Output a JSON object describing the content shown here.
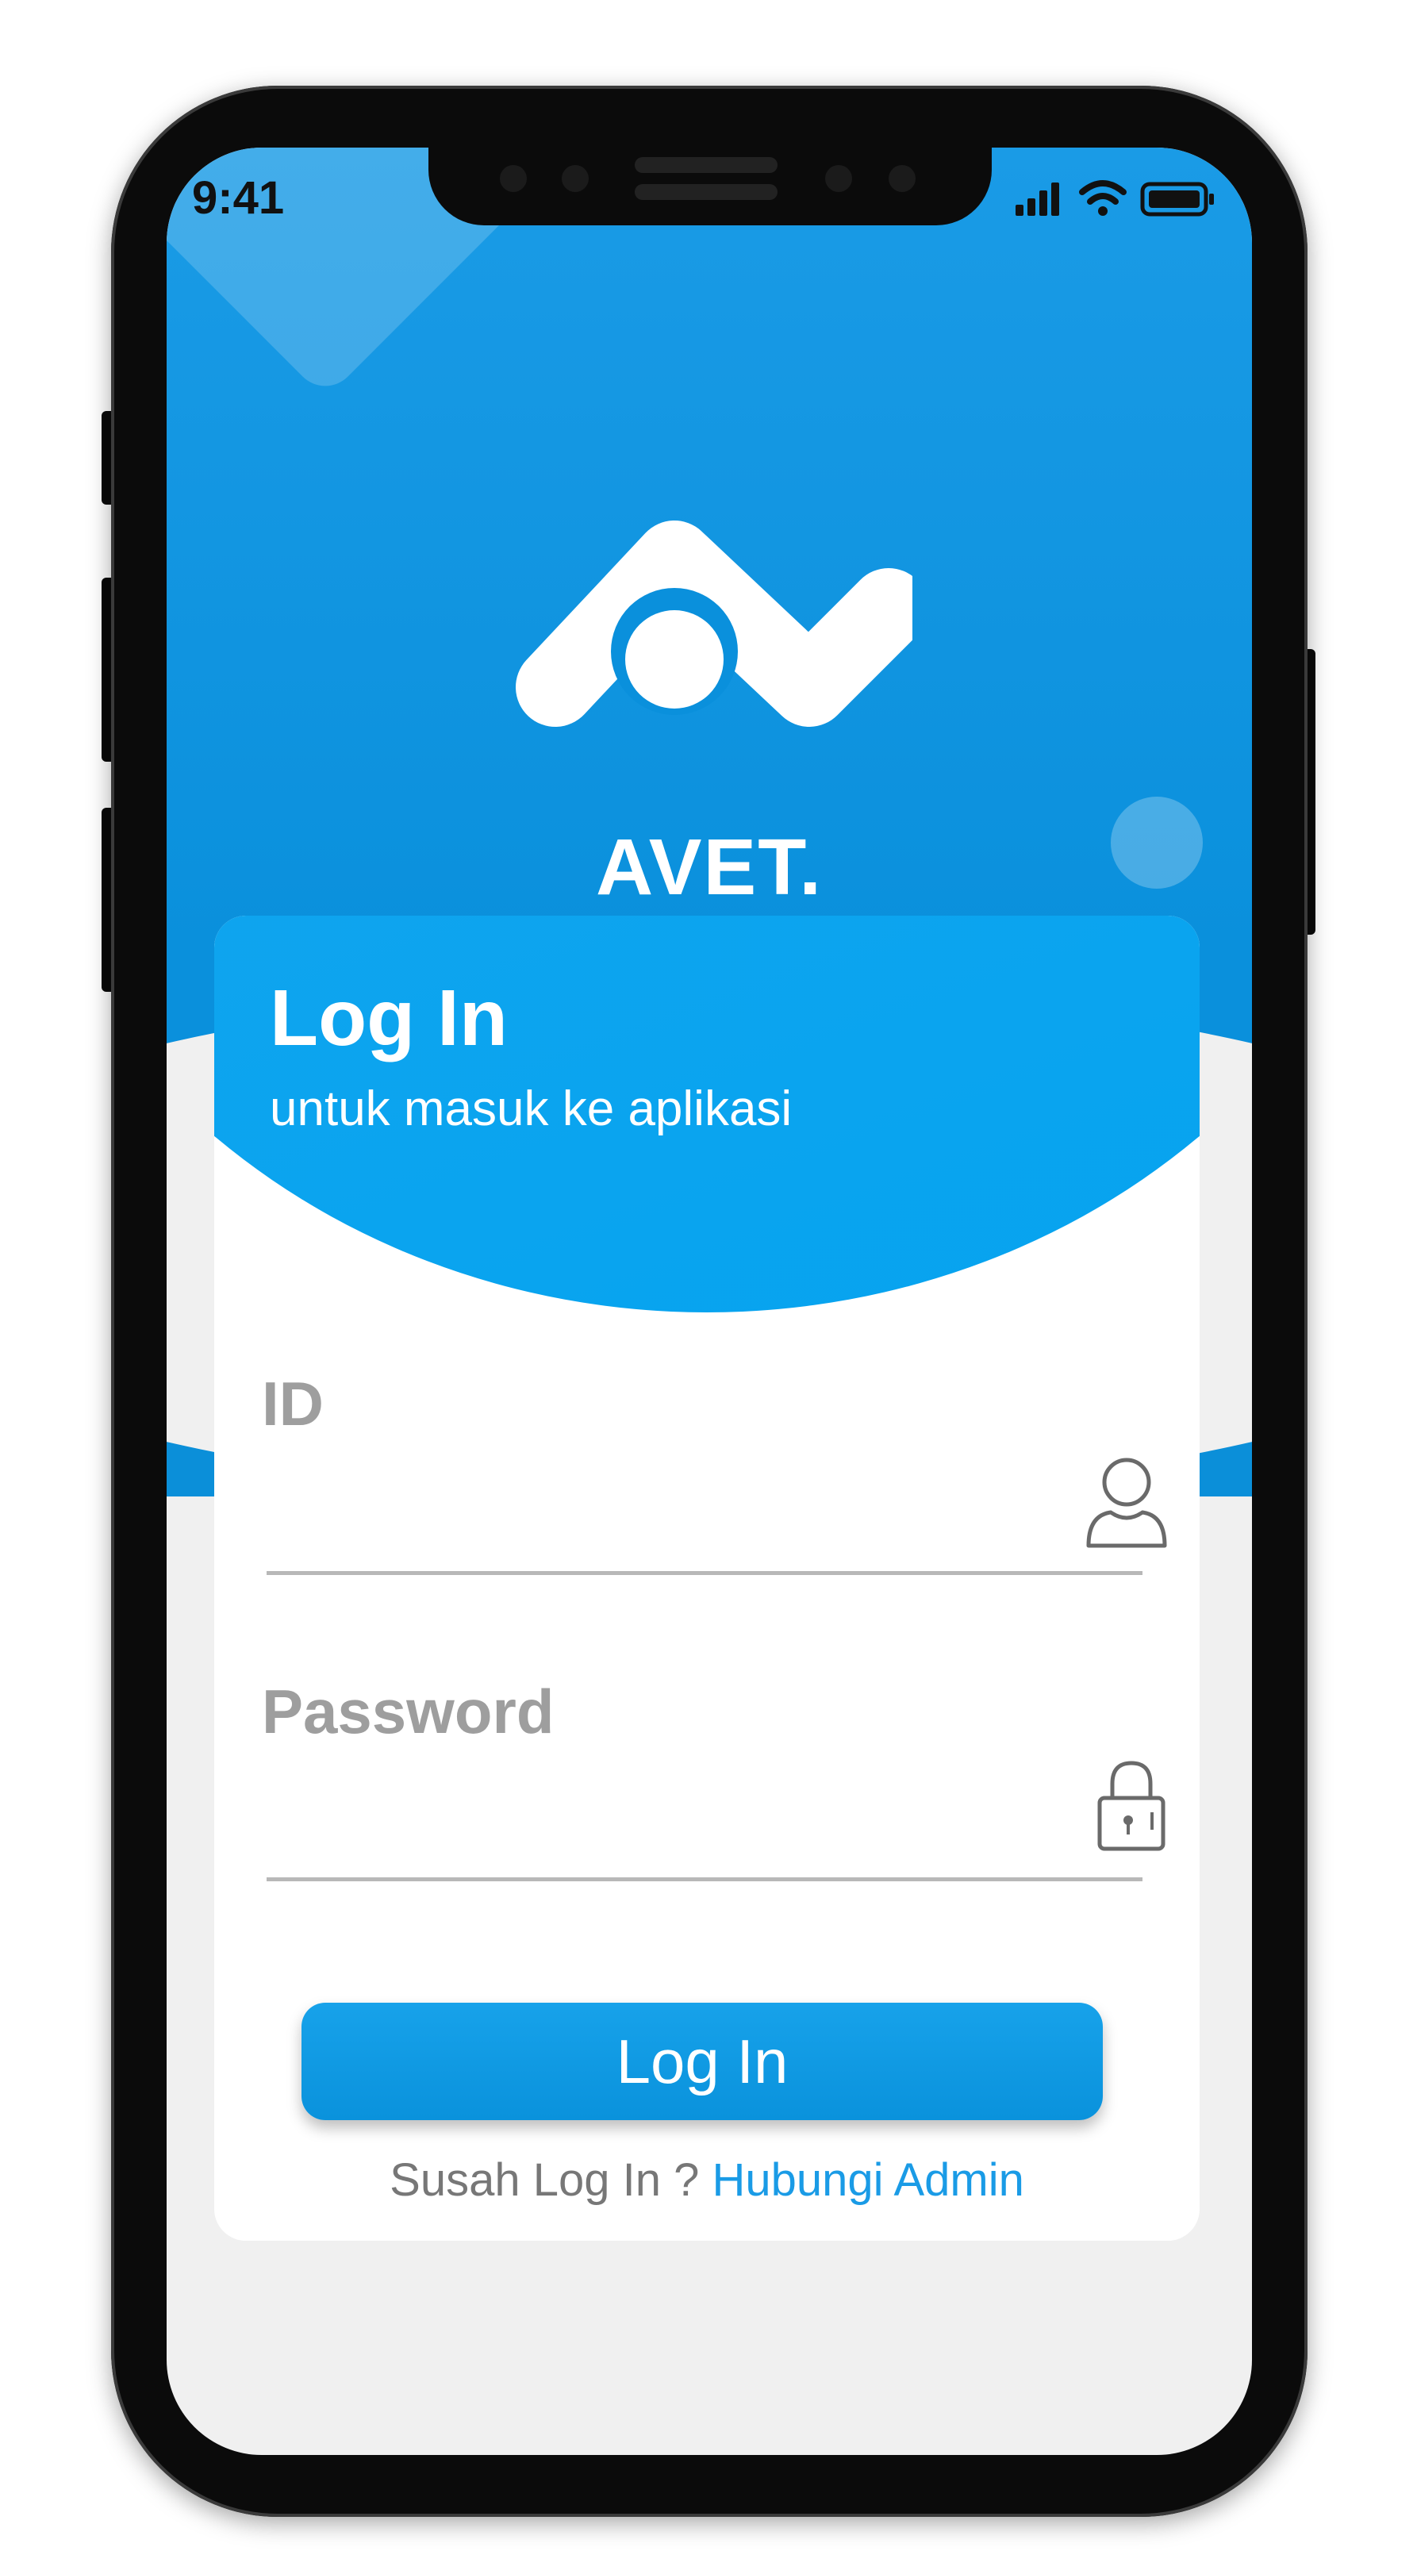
{
  "status_bar": {
    "time": "9:41",
    "icons": [
      "cellular-signal-icon",
      "wifi-icon",
      "battery-icon"
    ]
  },
  "brand": {
    "name": "AVET.",
    "logo": "avet-logo-icon"
  },
  "login_card": {
    "title": "Log In",
    "subtitle": "untuk masuk ke aplikasi"
  },
  "form": {
    "id_label": "ID",
    "id_value": "",
    "id_icon": "user-icon",
    "password_label": "Password",
    "password_value": "",
    "password_icon": "lock-icon"
  },
  "login_button": {
    "label": "Log In"
  },
  "help": {
    "question": "Susah Log In ?",
    "link": "Hubungi Admin"
  },
  "colors": {
    "primary": "#0A90DC",
    "card_header": "#05A3EF",
    "link": "#1A9BE6",
    "placeholder": "#9E9E9E",
    "background": "#F0F0F0"
  }
}
